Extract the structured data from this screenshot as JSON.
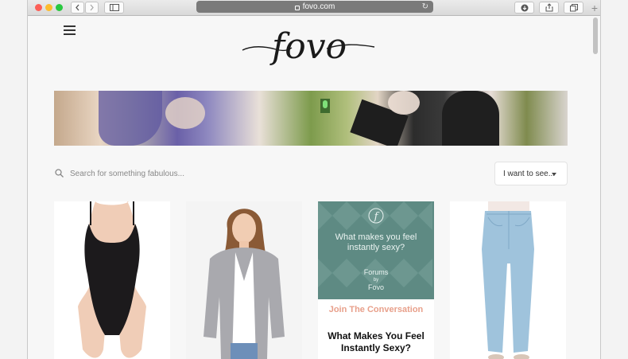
{
  "browser": {
    "url": "fovo.com",
    "colors": {
      "close": "#fc5f57",
      "minimize": "#fdbc2e",
      "maximize": "#29c840"
    },
    "icons": [
      "back-icon",
      "forward-icon",
      "sidebar-icon",
      "reload-icon",
      "download-icon",
      "share-icon",
      "tabs-icon",
      "new-tab-icon"
    ]
  },
  "header": {
    "menu_icon": "hamburger-icon",
    "logo_text": "fovo"
  },
  "search": {
    "placeholder": "Search for something fabulous...",
    "value": ""
  },
  "filter": {
    "label": "I want to see..."
  },
  "cards": [
    {
      "kind": "product",
      "image": "black bodysuit"
    },
    {
      "kind": "product",
      "image": "grey cardigan outfit"
    },
    {
      "kind": "promo",
      "question": "What makes you feel instantly sexy?",
      "forums_label": "Forums",
      "by_label": "by",
      "brand_label": "Fovo",
      "cta": "Join The Conversation",
      "title": "What Makes You Feel Instantly Sexy?",
      "accent": "#5e8a83"
    },
    {
      "kind": "product",
      "image": "light blue skinny jeans"
    }
  ]
}
